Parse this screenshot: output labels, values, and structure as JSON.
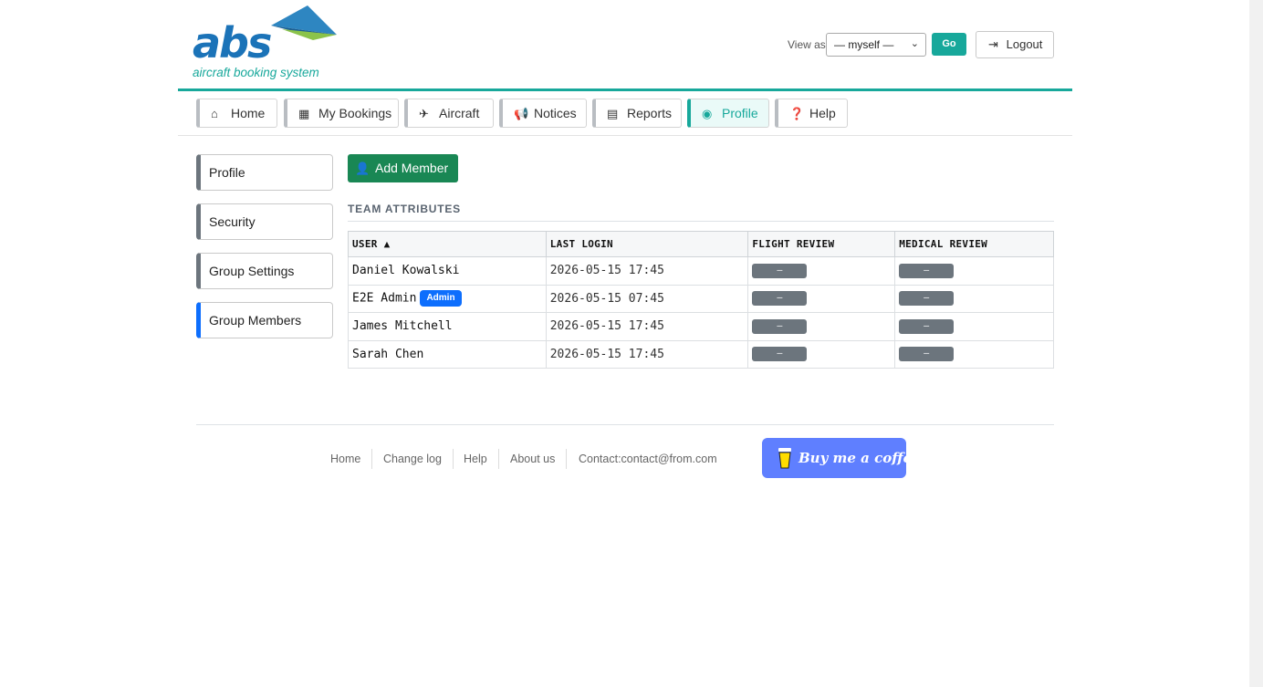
{
  "brand": {
    "logo_text": "abs",
    "tagline": "aircraft booking system",
    "colors": {
      "teal": "#17a89b",
      "blue": "#1b73b8",
      "green": "#198754",
      "primary": "#0d6efd",
      "grey": "#6c757d"
    }
  },
  "header": {
    "view_as_label": "View as",
    "view_as_selected": "— myself —",
    "go_label": "Go",
    "logout_label": "Logout",
    "logout_icon": "logout-icon"
  },
  "nav": {
    "tabs": [
      {
        "label": "Home",
        "icon": "home-icon",
        "active": false
      },
      {
        "label": "My Bookings",
        "icon": "calendar-icon",
        "active": false
      },
      {
        "label": "Aircraft",
        "icon": "plane-icon",
        "active": false
      },
      {
        "label": "Notices",
        "icon": "megaphone-icon",
        "active": false
      },
      {
        "label": "Reports",
        "icon": "chart-icon",
        "active": false
      },
      {
        "label": "Profile",
        "icon": "user-circle-icon",
        "active": true
      },
      {
        "label": "Help",
        "icon": "question-icon",
        "active": false
      }
    ]
  },
  "sidebar": {
    "items": [
      {
        "label": "Profile",
        "active": false
      },
      {
        "label": "Security",
        "active": false
      },
      {
        "label": "Group Settings",
        "active": false
      },
      {
        "label": "Group Members",
        "active": true
      }
    ]
  },
  "main": {
    "add_member_label": "Add Member",
    "section_title": "TEAM ATTRIBUTES",
    "table": {
      "headers": [
        "USER ▲",
        "LAST LOGIN",
        "FLIGHT REVIEW",
        "MEDICAL REVIEW"
      ],
      "rows": [
        {
          "user": "Daniel Kowalski",
          "badge": "",
          "last_login": "2026-05-15 17:45",
          "flight_review": "—",
          "medical_review": "—"
        },
        {
          "user": "E2E Admin",
          "badge": "Admin",
          "last_login": "2026-05-15 07:45",
          "flight_review": "—",
          "medical_review": "—"
        },
        {
          "user": "James Mitchell",
          "badge": "",
          "last_login": "2026-05-15 17:45",
          "flight_review": "—",
          "medical_review": "—"
        },
        {
          "user": "Sarah Chen",
          "badge": "",
          "last_login": "2026-05-15 17:45",
          "flight_review": "—",
          "medical_review": "—"
        }
      ]
    }
  },
  "footer": {
    "links": [
      "Home",
      "Change log",
      "Help",
      "About us",
      "Contact:contact@from.com"
    ],
    "coffee_label": "Buy me a coffee"
  }
}
